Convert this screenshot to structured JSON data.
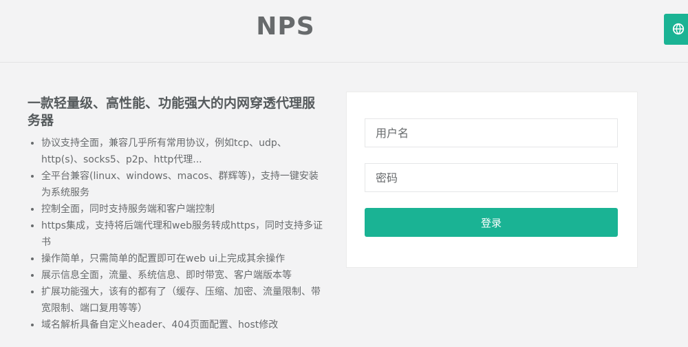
{
  "header": {
    "logo": "NPS"
  },
  "language_button": {
    "icon": "globe-icon",
    "color": "#1ab394"
  },
  "intro": {
    "title": "一款轻量级、高性能、功能强大的内网穿透代理服务器",
    "features": [
      "协议支持全面，兼容几乎所有常用协议，例如tcp、udp、http(s)、socks5、p2p、http代理...",
      "全平台兼容(linux、windows、macos、群辉等)，支持一键安装为系统服务",
      "控制全面，同时支持服务端和客户端控制",
      "https集成，支持将后端代理和web服务转成https，同时支持多证书",
      "操作简单，只需简单的配置即可在web ui上完成其余操作",
      "展示信息全面，流量、系统信息、即时带宽、客户端版本等",
      "扩展功能强大，该有的都有了（缓存、压缩、加密、流量限制、带宽限制、端口复用等等）",
      "域名解析具备自定义header、404页面配置、host修改"
    ]
  },
  "login": {
    "username_placeholder": "用户名",
    "password_placeholder": "密码",
    "submit_label": "登录",
    "accent_color": "#1ab394"
  }
}
